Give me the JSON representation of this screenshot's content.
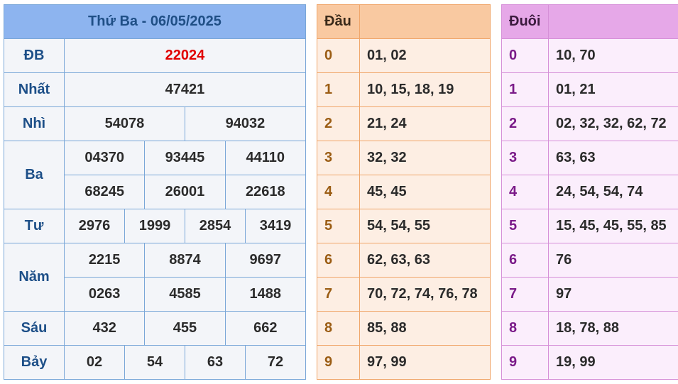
{
  "result": {
    "title": "Thứ Ba - 06/05/2025",
    "prizes": {
      "db": {
        "label": "ĐB",
        "values": [
          "22024"
        ]
      },
      "nhat": {
        "label": "Nhất",
        "values": [
          "47421"
        ]
      },
      "nhi": {
        "label": "Nhì",
        "values": [
          "54078",
          "94032"
        ]
      },
      "ba": {
        "label": "Ba",
        "values": [
          "04370",
          "93445",
          "44110",
          "68245",
          "26001",
          "22618"
        ]
      },
      "tu": {
        "label": "Tư",
        "values": [
          "2976",
          "1999",
          "2854",
          "3419"
        ]
      },
      "nam": {
        "label": "Năm",
        "values": [
          "2215",
          "8874",
          "9697",
          "0263",
          "4585",
          "1488"
        ]
      },
      "sau": {
        "label": "Sáu",
        "values": [
          "432",
          "455",
          "662"
        ]
      },
      "bay": {
        "label": "Bảy",
        "values": [
          "02",
          "54",
          "63",
          "72"
        ]
      }
    },
    "special_color": "#e10000"
  },
  "dau": {
    "header": "Đầu",
    "rows": [
      {
        "digit": "0",
        "values": "01, 02"
      },
      {
        "digit": "1",
        "values": "10, 15, 18, 19"
      },
      {
        "digit": "2",
        "values": "21, 24"
      },
      {
        "digit": "3",
        "values": "32, 32"
      },
      {
        "digit": "4",
        "values": "45, 45"
      },
      {
        "digit": "5",
        "values": "54, 54, 55"
      },
      {
        "digit": "6",
        "values": "62, 63, 63"
      },
      {
        "digit": "7",
        "values": "70, 72, 74, 76, 78"
      },
      {
        "digit": "8",
        "values": "85, 88"
      },
      {
        "digit": "9",
        "values": "97, 99"
      }
    ]
  },
  "duoi": {
    "header": "Đuôi",
    "rows": [
      {
        "digit": "0",
        "values": "10, 70"
      },
      {
        "digit": "1",
        "values": "01, 21"
      },
      {
        "digit": "2",
        "values": "02, 32, 32, 62, 72"
      },
      {
        "digit": "3",
        "values": "63, 63"
      },
      {
        "digit": "4",
        "values": "24, 54, 54, 74"
      },
      {
        "digit": "5",
        "values": "15, 45, 45, 55, 85"
      },
      {
        "digit": "6",
        "values": "76"
      },
      {
        "digit": "7",
        "values": "97"
      },
      {
        "digit": "8",
        "values": "18, 78, 88"
      },
      {
        "digit": "9",
        "values": "19, 99"
      }
    ]
  }
}
